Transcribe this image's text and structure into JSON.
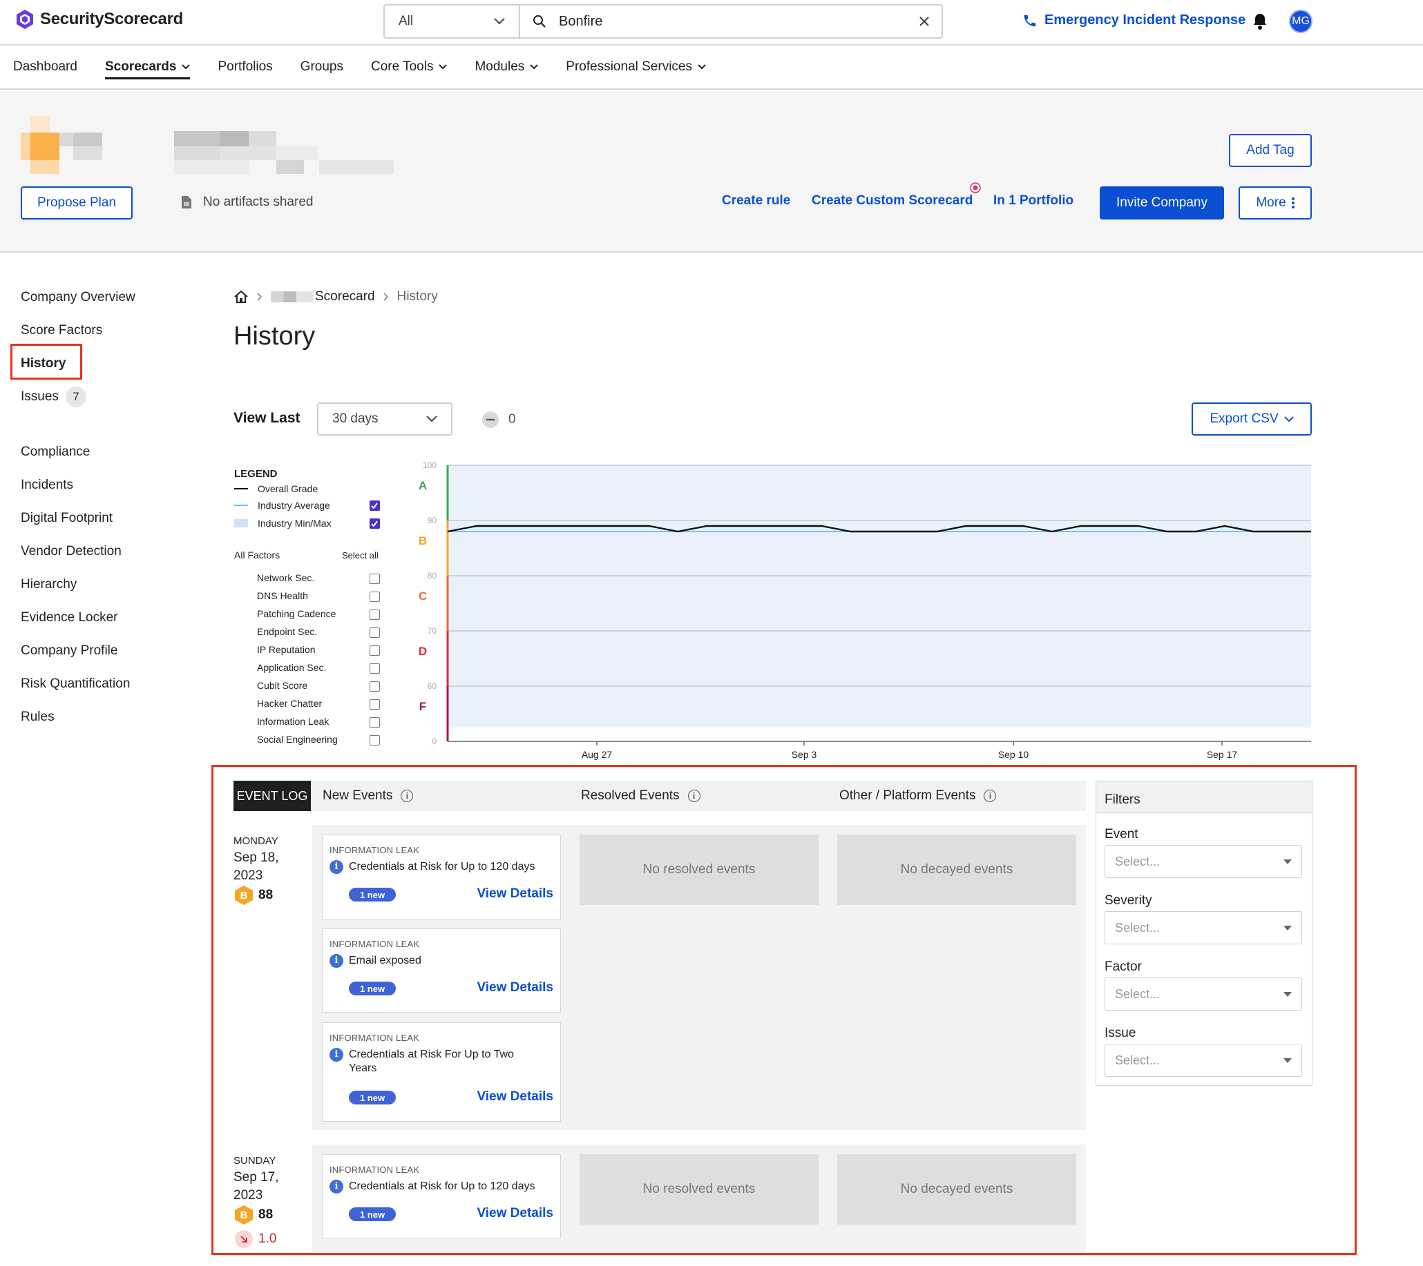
{
  "brand": {
    "name": "SecurityScorecard"
  },
  "search": {
    "scope": "All",
    "value": "Bonfire"
  },
  "header": {
    "emergency": "Emergency Incident Response",
    "avatar_initials": "MG"
  },
  "nav": [
    {
      "label": "Dashboard"
    },
    {
      "label": "Scorecards",
      "active": true,
      "dropdown": true
    },
    {
      "label": "Portfolios"
    },
    {
      "label": "Groups"
    },
    {
      "label": "Core Tools",
      "dropdown": true
    },
    {
      "label": "Modules",
      "dropdown": true
    },
    {
      "label": "Professional Services",
      "dropdown": true
    }
  ],
  "company": {
    "add_tag": "Add Tag",
    "propose_plan": "Propose Plan",
    "artifacts": "No artifacts shared",
    "create_rule": "Create rule",
    "create_custom": "Create Custom Scorecard",
    "portfolio": "In 1 Portfolio",
    "invite": "Invite Company",
    "more": "More"
  },
  "sidebar": {
    "items": [
      {
        "label": "Company Overview"
      },
      {
        "label": "Score Factors"
      },
      {
        "label": "History",
        "active": true
      },
      {
        "label": "Issues",
        "count": "7"
      },
      {
        "label": "Compliance"
      },
      {
        "label": "Incidents"
      },
      {
        "label": "Digital Footprint"
      },
      {
        "label": "Vendor Detection"
      },
      {
        "label": "Hierarchy"
      },
      {
        "label": "Evidence Locker"
      },
      {
        "label": "Company Profile"
      },
      {
        "label": "Risk Quantification"
      },
      {
        "label": "Rules"
      }
    ]
  },
  "breadcrumb": {
    "scorecard": "Scorecard",
    "current": "History"
  },
  "page": {
    "title": "History"
  },
  "controls": {
    "view_last": "View Last",
    "range": "30 days",
    "change": "0",
    "export": "Export CSV"
  },
  "legend": {
    "title": "LEGEND",
    "overall": "Overall Grade",
    "industry_avg": "Industry Average",
    "industry_minmax": "Industry Min/Max",
    "all_factors": "All Factors",
    "select_all": "Select all",
    "factors": [
      "Network Sec.",
      "DNS Health",
      "Patching Cadence",
      "Endpoint Sec.",
      "IP Reputation",
      "Application Sec.",
      "Cubit Score",
      "Hacker Chatter",
      "Information Leak",
      "Social Engineering"
    ]
  },
  "chart_data": {
    "type": "line",
    "y_ticks": [
      "100",
      "90",
      "80",
      "70",
      "60",
      "0"
    ],
    "grades": [
      {
        "label": "A",
        "color": "#3aa757"
      },
      {
        "label": "B",
        "color": "#f6a623"
      },
      {
        "label": "C",
        "color": "#f26b2c"
      },
      {
        "label": "D",
        "color": "#e0283a"
      },
      {
        "label": "F",
        "color": "#b5124a"
      }
    ],
    "x_ticks": [
      "Aug 27",
      "Sep 3",
      "Sep 10",
      "Sep 17"
    ],
    "series": [
      {
        "name": "Overall Grade",
        "color": "#111111",
        "values": [
          88,
          89,
          89,
          89,
          89,
          89,
          89,
          89,
          88,
          89,
          89,
          89,
          89,
          89,
          88,
          88,
          88,
          88,
          89,
          89,
          89,
          88,
          89,
          89,
          89,
          88,
          88,
          89,
          88,
          88,
          88
        ]
      },
      {
        "name": "Industry Average",
        "color": "#6cc6e8",
        "values": [
          88,
          88,
          88,
          88,
          88,
          88,
          88,
          88,
          88,
          88,
          88,
          88,
          88,
          88,
          88,
          88,
          88,
          88,
          88,
          88,
          88,
          88,
          88,
          88,
          88,
          88,
          88,
          88,
          88,
          88,
          88
        ]
      }
    ]
  },
  "eventlog": {
    "tab": "EVENT LOG",
    "new_events": "New Events",
    "resolved_events": "Resolved Events",
    "other_events": "Other / Platform Events",
    "days": [
      {
        "weekday": "MONDAY",
        "date_line1": "Sep 18,",
        "date_line2": "2023",
        "grade": "B",
        "score": "88",
        "events": [
          {
            "category": "INFORMATION LEAK",
            "title": "Credentials at Risk for Up to 120 days",
            "pill": "1 new",
            "link": "View Details"
          },
          {
            "category": "INFORMATION LEAK",
            "title": "Email exposed",
            "pill": "1 new",
            "link": "View Details"
          },
          {
            "category": "INFORMATION LEAK",
            "title": "Credentials at Risk For Up to Two Years",
            "pill": "1 new",
            "link": "View Details"
          }
        ],
        "resolved": "No resolved events",
        "decayed": "No decayed events"
      },
      {
        "weekday": "SUNDAY",
        "date_line1": "Sep 17,",
        "date_line2": "2023",
        "grade": "B",
        "score": "88",
        "delta": "1.0",
        "events": [
          {
            "category": "INFORMATION LEAK",
            "title": "Credentials at Risk for Up to 120 days",
            "pill": "1 new",
            "link": "View Details"
          }
        ],
        "resolved": "No resolved events",
        "decayed": "No decayed events"
      }
    ]
  },
  "filters": {
    "title": "Filters",
    "fields": [
      {
        "label": "Event",
        "placeholder": "Select..."
      },
      {
        "label": "Severity",
        "placeholder": "Select..."
      },
      {
        "label": "Factor",
        "placeholder": "Select..."
      },
      {
        "label": "Issue",
        "placeholder": "Select..."
      }
    ]
  }
}
